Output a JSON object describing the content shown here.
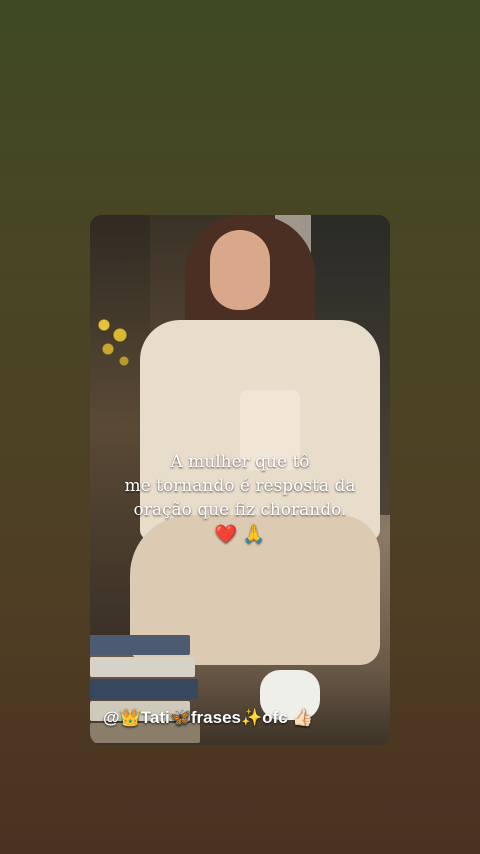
{
  "quote": {
    "line1": "A mulher que tô",
    "line2": "me tornando é resposta da",
    "line3": "oração que fiz chorando.",
    "emoji_heart": "❤️",
    "emoji_pray": "🙏"
  },
  "handle": {
    "at": "@",
    "crown": "👑",
    "name": "Tati",
    "butterfly": "🦋",
    "word": "frases",
    "sparkle": "✨",
    "suffix": "ofc",
    "hand": "👍🏻"
  },
  "colors": {
    "background_top": "#3f4a22",
    "background_bottom": "#4a3220",
    "text": "#ffffff"
  }
}
